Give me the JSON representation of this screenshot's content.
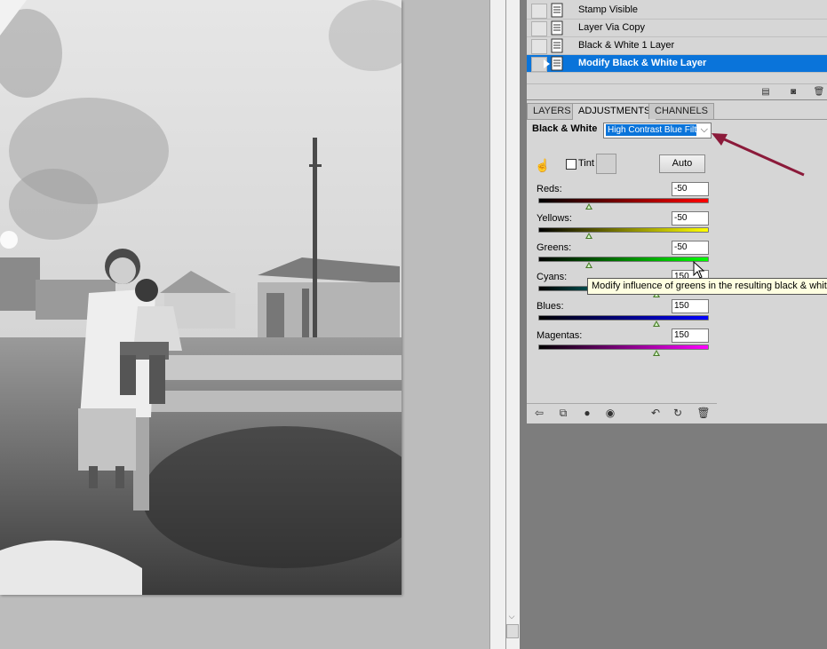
{
  "history": {
    "items": [
      {
        "label": "Stamp Visible",
        "active": false
      },
      {
        "label": "Layer Via Copy",
        "active": false
      },
      {
        "label": "Black & White 1 Layer",
        "active": false
      },
      {
        "label": "Modify Black & White Layer",
        "active": true
      }
    ]
  },
  "tabs": [
    "LAYERS",
    "ADJUSTMENTS",
    "CHANNELS"
  ],
  "active_tab": "ADJUSTMENTS",
  "adjustments": {
    "title": "Black & White",
    "preset": "High Contrast Blue Filter",
    "tint_label": "Tint",
    "tint_checked": false,
    "auto_label": "Auto",
    "sliders": [
      {
        "label": "Reds:",
        "value": "-50",
        "level": -50,
        "from": "#000000",
        "to": "#ff0000"
      },
      {
        "label": "Yellows:",
        "value": "-50",
        "level": -50,
        "from": "#000000",
        "to": "#ffff00"
      },
      {
        "label": "Greens:",
        "value": "-50",
        "level": -50,
        "from": "#000000",
        "to": "#00ff00"
      },
      {
        "label": "Cyans:",
        "value": "150",
        "level": 150,
        "from": "#000000",
        "to": "#00ffff"
      },
      {
        "label": "Blues:",
        "value": "150",
        "level": 150,
        "from": "#000000",
        "to": "#0000ff"
      },
      {
        "label": "Magentas:",
        "value": "150",
        "level": 150,
        "from": "#000000",
        "to": "#ff00ff"
      }
    ]
  },
  "tooltip": "Modify influence of greens in the resulting black & white",
  "colors": {
    "selection": "#0a74da",
    "annotation_arrow": "#8b1a3a",
    "thumb": "#4a7a2a"
  }
}
